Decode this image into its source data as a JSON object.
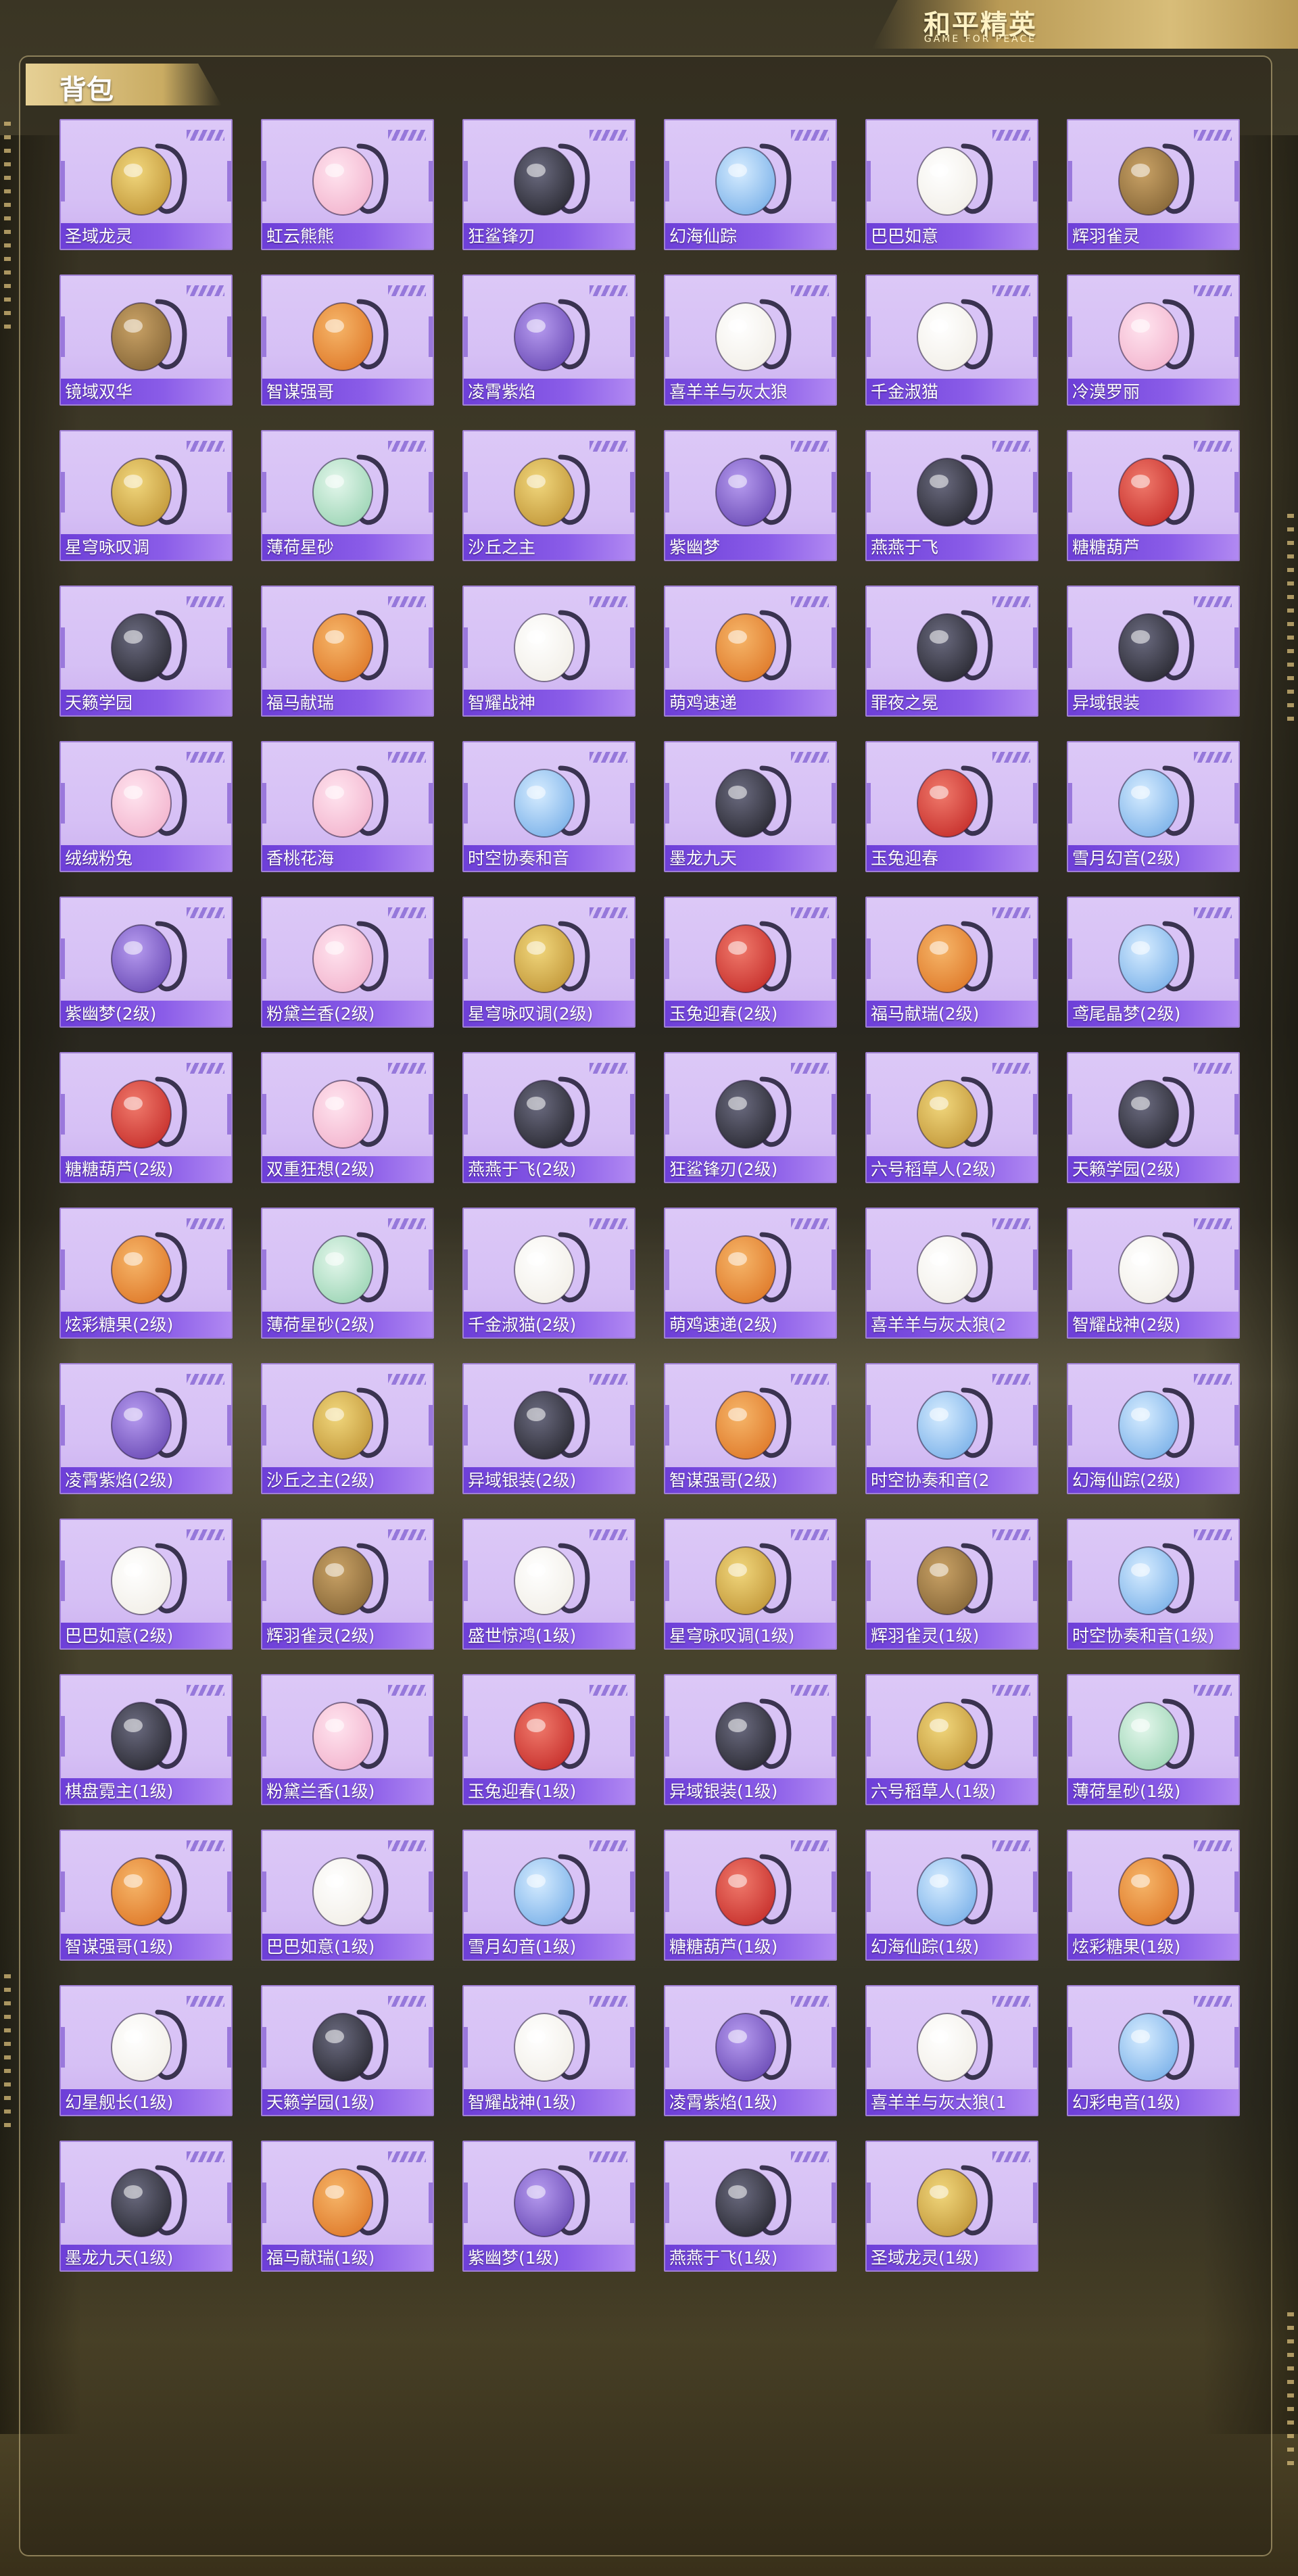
{
  "header": {
    "logo_title": "和平精英",
    "logo_subtitle": "GAME FOR PEACE",
    "section_title": "背包"
  },
  "colors": {
    "card_bg": "#d9c4f6",
    "card_border": "#a080d4",
    "label_bar": "#7a4ce0",
    "header_gold": "#d8bd79"
  },
  "items": [
    {
      "name": "圣域龙灵",
      "icon": "gold-dragon-emblem"
    },
    {
      "name": "虹云熊熊",
      "icon": "pink-bear-cloud"
    },
    {
      "name": "狂鲨锋刃",
      "icon": "shark-blade"
    },
    {
      "name": "幻海仙踪",
      "icon": "sea-crystal"
    },
    {
      "name": "巴巴如意",
      "icon": "bunny-plush"
    },
    {
      "name": "辉羽雀灵",
      "icon": "feather-bird"
    },
    {
      "name": "镜域双华",
      "icon": "mirror-flower"
    },
    {
      "name": "智谋强哥",
      "icon": "bear-plush"
    },
    {
      "name": "凌霄紫焰",
      "icon": "purple-flame"
    },
    {
      "name": "喜羊羊与灰太狼",
      "icon": "sheep-plush"
    },
    {
      "name": "千金淑猫",
      "icon": "cat-plush"
    },
    {
      "name": "冷漠罗丽",
      "icon": "doll-plush"
    },
    {
      "name": "星穹咏叹调",
      "icon": "gold-harp"
    },
    {
      "name": "薄荷星砂",
      "icon": "mint-bag"
    },
    {
      "name": "沙丘之主",
      "icon": "dune-scroll"
    },
    {
      "name": "紫幽梦",
      "icon": "purple-orb"
    },
    {
      "name": "燕燕于飞",
      "icon": "helmet-bag"
    },
    {
      "name": "糖糖葫芦",
      "icon": "candy-gourd"
    },
    {
      "name": "天籁学园",
      "icon": "keyboard-bag"
    },
    {
      "name": "福马献瑞",
      "icon": "orange-bunny"
    },
    {
      "name": "智耀战神",
      "icon": "white-bust"
    },
    {
      "name": "萌鸡速递",
      "icon": "chick-plush"
    },
    {
      "name": "罪夜之冕",
      "icon": "dark-crown"
    },
    {
      "name": "异域银装",
      "icon": "tactical-pack"
    },
    {
      "name": "绒绒粉兔",
      "icon": "pink-bunny"
    },
    {
      "name": "香桃花海",
      "icon": "peach-flower"
    },
    {
      "name": "时空协奏和音",
      "icon": "blue-butterfly"
    },
    {
      "name": "墨龙九天",
      "icon": "black-dragon"
    },
    {
      "name": "玉兔迎春",
      "icon": "red-backpack"
    },
    {
      "name": "雪月幻音(2级)",
      "icon": "snow-mask"
    },
    {
      "name": "紫幽梦(2级)",
      "icon": "purple-orb"
    },
    {
      "name": "粉黛兰香(2级)",
      "icon": "pink-round"
    },
    {
      "name": "星穹咏叹调(2级)",
      "icon": "gold-harp"
    },
    {
      "name": "玉兔迎春(2级)",
      "icon": "red-backpack"
    },
    {
      "name": "福马献瑞(2级)",
      "icon": "orange-bunny"
    },
    {
      "name": "鸢尾晶梦(2级)",
      "icon": "crystal-orb"
    },
    {
      "name": "糖糖葫芦(2级)",
      "icon": "candy-gourd"
    },
    {
      "name": "双重狂想(2级)",
      "icon": "double-doll"
    },
    {
      "name": "燕燕于飞(2级)",
      "icon": "helmet-bag"
    },
    {
      "name": "狂鲨锋刃(2级)",
      "icon": "shark-blade"
    },
    {
      "name": "六号稻草人(2级)",
      "icon": "scarecrow"
    },
    {
      "name": "天籁学园(2级)",
      "icon": "keyboard-bag"
    },
    {
      "name": "炫彩糖果(2级)",
      "icon": "candy-orb"
    },
    {
      "name": "薄荷星砂(2级)",
      "icon": "mint-bag"
    },
    {
      "name": "千金淑猫(2级)",
      "icon": "cat-plush"
    },
    {
      "name": "萌鸡速递(2级)",
      "icon": "chick-plush"
    },
    {
      "name": "喜羊羊与灰太狼(2",
      "icon": "sheep-plush"
    },
    {
      "name": "智耀战神(2级)",
      "icon": "white-bust"
    },
    {
      "name": "凌霄紫焰(2级)",
      "icon": "purple-flame"
    },
    {
      "name": "沙丘之主(2级)",
      "icon": "dune-scroll"
    },
    {
      "name": "异域银装(2级)",
      "icon": "tactical-pack"
    },
    {
      "name": "智谋强哥(2级)",
      "icon": "bear-plush"
    },
    {
      "name": "时空协奏和音(2",
      "icon": "blue-butterfly"
    },
    {
      "name": "幻海仙踪(2级)",
      "icon": "sea-crystal"
    },
    {
      "name": "巴巴如意(2级)",
      "icon": "bunny-plush"
    },
    {
      "name": "辉羽雀灵(2级)",
      "icon": "feather-bird"
    },
    {
      "name": "盛世惊鸿(1级)",
      "icon": "pearl-shell"
    },
    {
      "name": "星穹咏叹调(1级)",
      "icon": "gold-harp"
    },
    {
      "name": "辉羽雀灵(1级)",
      "icon": "feather-bird"
    },
    {
      "name": "时空协奏和音(1级)",
      "icon": "blue-butterfly"
    },
    {
      "name": "棋盘霓主(1级)",
      "icon": "chess-heart"
    },
    {
      "name": "粉黛兰香(1级)",
      "icon": "pink-round"
    },
    {
      "name": "玉兔迎春(1级)",
      "icon": "red-backpack"
    },
    {
      "name": "异域银装(1级)",
      "icon": "tactical-pack"
    },
    {
      "name": "六号稻草人(1级)",
      "icon": "scarecrow"
    },
    {
      "name": "薄荷星砂(1级)",
      "icon": "mint-bag"
    },
    {
      "name": "智谋强哥(1级)",
      "icon": "bear-plush"
    },
    {
      "name": "巴巴如意(1级)",
      "icon": "bunny-plush"
    },
    {
      "name": "雪月幻音(1级)",
      "icon": "snow-mask"
    },
    {
      "name": "糖糖葫芦(1级)",
      "icon": "candy-gourd"
    },
    {
      "name": "幻海仙踪(1级)",
      "icon": "sea-crystal"
    },
    {
      "name": "炫彩糖果(1级)",
      "icon": "candy-orb"
    },
    {
      "name": "幻星舰长(1级)",
      "icon": "eyeball-bunny"
    },
    {
      "name": "天籁学园(1级)",
      "icon": "keyboard-bag"
    },
    {
      "name": "智耀战神(1级)",
      "icon": "white-bust"
    },
    {
      "name": "凌霄紫焰(1级)",
      "icon": "purple-flame"
    },
    {
      "name": "喜羊羊与灰太狼(1",
      "icon": "sheep-plush"
    },
    {
      "name": "幻彩电音(1级)",
      "icon": "blue-speaker"
    },
    {
      "name": "墨龙九天(1级)",
      "icon": "black-dragon"
    },
    {
      "name": "福马献瑞(1级)",
      "icon": "orange-bunny"
    },
    {
      "name": "紫幽梦(1级)",
      "icon": "purple-orb"
    },
    {
      "name": "燕燕于飞(1级)",
      "icon": "helmet-bag"
    },
    {
      "name": "圣域龙灵(1级)",
      "icon": "gold-dragon-emblem"
    }
  ]
}
